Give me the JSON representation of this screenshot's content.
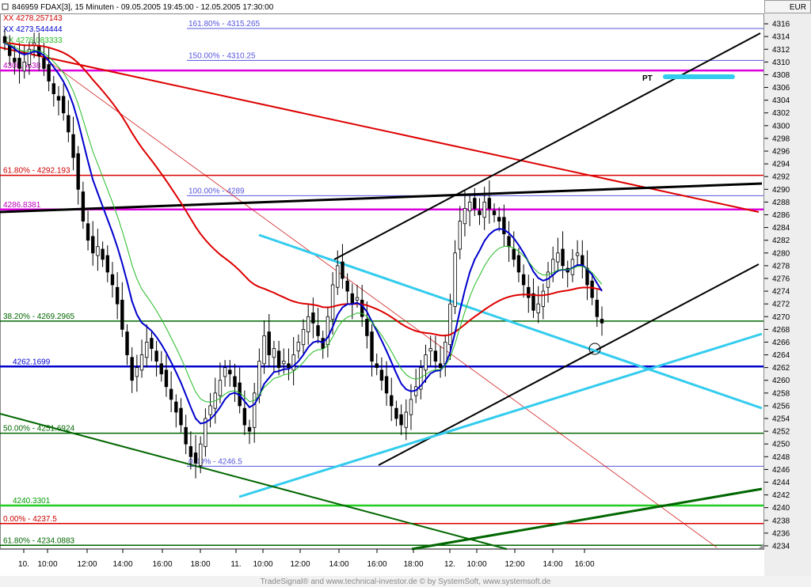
{
  "header": {
    "title": "846959  FDAX[3], 15 Minuten - 09.05.2005 19:45:00 - 12.05.2005 17:30:00",
    "currency": "EUR",
    "indicators": [
      {
        "label": "XX 4278.257143",
        "color": "#cc0000"
      },
      {
        "label": "XX 4273.544444",
        "color": "#0000cc"
      },
      {
        "label": "XX 4276.083333",
        "color": "#22bb22"
      }
    ]
  },
  "footer": {
    "credit": "TradeSignal® and www.technical-investor.de © by SystemSoft, www.systemsoft.de"
  },
  "chart_data": {
    "type": "candlestick",
    "ylim": [
      4233.5,
      4317.5
    ],
    "y_ticks": [
      4234,
      4236,
      4238,
      4240,
      4242,
      4244,
      4246,
      4248,
      4250,
      4252,
      4254,
      4256,
      4258,
      4260,
      4262,
      4264,
      4266,
      4268,
      4270,
      4272,
      4274,
      4276,
      4278,
      4280,
      4282,
      4284,
      4286,
      4288,
      4290,
      4292,
      4294,
      4296,
      4298,
      4300,
      4302,
      4304,
      4306,
      4308,
      4310,
      4312,
      4314,
      4316
    ],
    "x_ticks": [
      "10.",
      "10:00",
      "12:00",
      "14:00",
      "16:00",
      "18:00",
      "11.",
      "10:00",
      "12:00",
      "14:00",
      "16:00",
      "18:00",
      "12.",
      "10:00",
      "12:00",
      "14:00",
      "16:00"
    ],
    "horizontal_levels": [
      {
        "label": "161.80% - 4315.265",
        "value": 4315.265,
        "color": "#5555dd",
        "label_color": "#5555dd"
      },
      {
        "label": "150.00% - 4310.25",
        "value": 4310.25,
        "color": "#5555dd",
        "label_color": "#5555dd"
      },
      {
        "label": "4308.6638",
        "value": 4308.6638,
        "color": "#dd00dd",
        "label_color": "#bb00bb"
      },
      {
        "label": "61.80% - 4292.193",
        "value": 4292.193,
        "color": "#dd0000",
        "label_color": "#cc0000"
      },
      {
        "label": "100.00% - 4289",
        "value": 4289,
        "color": "#5555dd",
        "label_color": "#5555dd"
      },
      {
        "label": "4286.8381",
        "value": 4286.8381,
        "color": "#dd00dd",
        "label_color": "#bb00bb"
      },
      {
        "label": "38.20% - 4269.2965",
        "value": 4269.2965,
        "color": "#006600",
        "label_color": "#006600"
      },
      {
        "label": "4262.1699",
        "value": 4262.1699,
        "color": "#0000cc",
        "label_color": "#0000cc"
      },
      {
        "label": "50.00% - 4251.6924",
        "value": 4251.6924,
        "color": "#006600",
        "label_color": "#006600"
      },
      {
        "label": "0.00% - 4246.5",
        "value": 4246.5,
        "color": "#5555dd",
        "label_color": "#5555dd"
      },
      {
        "label": "4240.3301",
        "value": 4240.3301,
        "color": "#22cc22",
        "label_color": "#009900"
      },
      {
        "label": "0.00% - 4237.5",
        "value": 4237.5,
        "color": "#dd0000",
        "label_color": "#cc0000"
      },
      {
        "label": "61.80% - 4234.0883",
        "value": 4234.0883,
        "color": "#006600",
        "label_color": "#006600"
      }
    ],
    "annotation": {
      "label": "PT",
      "value": 4310
    },
    "close_series": [
      4313,
      4311,
      4310,
      4309,
      4310,
      4312,
      4313,
      4311,
      4309,
      4307,
      4305,
      4304,
      4302,
      4299,
      4295,
      4290,
      4285,
      4282,
      4280,
      4281,
      4279,
      4277,
      4275,
      4272,
      4268,
      4264,
      4260,
      4262,
      4264,
      4266,
      4265,
      4263,
      4261,
      4259,
      4257,
      4255,
      4253,
      4250,
      4248,
      4247,
      4250,
      4254,
      4256,
      4258,
      4260,
      4262,
      4261,
      4259,
      4256,
      4253,
      4252,
      4258,
      4263,
      4267,
      4264,
      4265,
      4262,
      4263,
      4262,
      4264,
      4266,
      4268,
      4270,
      4269,
      4267,
      4265,
      4270,
      4275,
      4278,
      4276,
      4274,
      4272,
      4273,
      4270,
      4267,
      4263,
      4262,
      4260,
      4258,
      4256,
      4254,
      4253,
      4255,
      4257,
      4259,
      4262,
      4264,
      4265,
      4263,
      4262,
      4266,
      4272,
      4280,
      4285,
      4287,
      4288,
      4287,
      4286,
      4288,
      4287,
      4286,
      4285,
      4283,
      4281,
      4279,
      4277,
      4275,
      4273,
      4271,
      4272,
      4274,
      4277,
      4279,
      4280,
      4278,
      4277,
      4279,
      4280,
      4278,
      4275,
      4273,
      4270,
      4269
    ],
    "series": [
      {
        "name": "XX 4278.257143",
        "color": "#dd0000",
        "period": 60
      },
      {
        "name": "XX 4273.544444",
        "color": "#0000cc",
        "period": 9
      },
      {
        "name": "XX 4276.083333",
        "color": "#22bb22",
        "period": 14
      }
    ]
  }
}
